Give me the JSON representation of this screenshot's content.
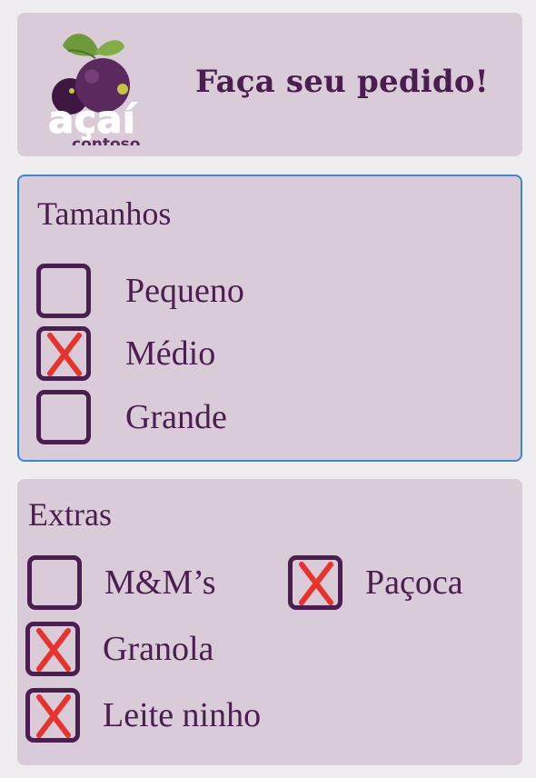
{
  "header": {
    "logo": {
      "word": "açaí",
      "sub": "contoso"
    },
    "title": "Faça seu pedido!"
  },
  "sizes": {
    "title": "Tamanhos",
    "options": [
      {
        "label": "Pequeno",
        "checked": false
      },
      {
        "label": "Médio",
        "checked": true
      },
      {
        "label": "Grande",
        "checked": false
      }
    ]
  },
  "extras": {
    "title": "Extras",
    "options": [
      {
        "label": "M&M’s",
        "checked": false
      },
      {
        "label": "Paçoca",
        "checked": true
      },
      {
        "label": "Granola",
        "checked": true
      },
      {
        "label": "Leite ninho",
        "checked": true
      }
    ]
  },
  "colors": {
    "accent": "#4a1f4f",
    "card": "#d9ccd8",
    "check": "#e8322c",
    "focus_border": "#3d86d6"
  }
}
